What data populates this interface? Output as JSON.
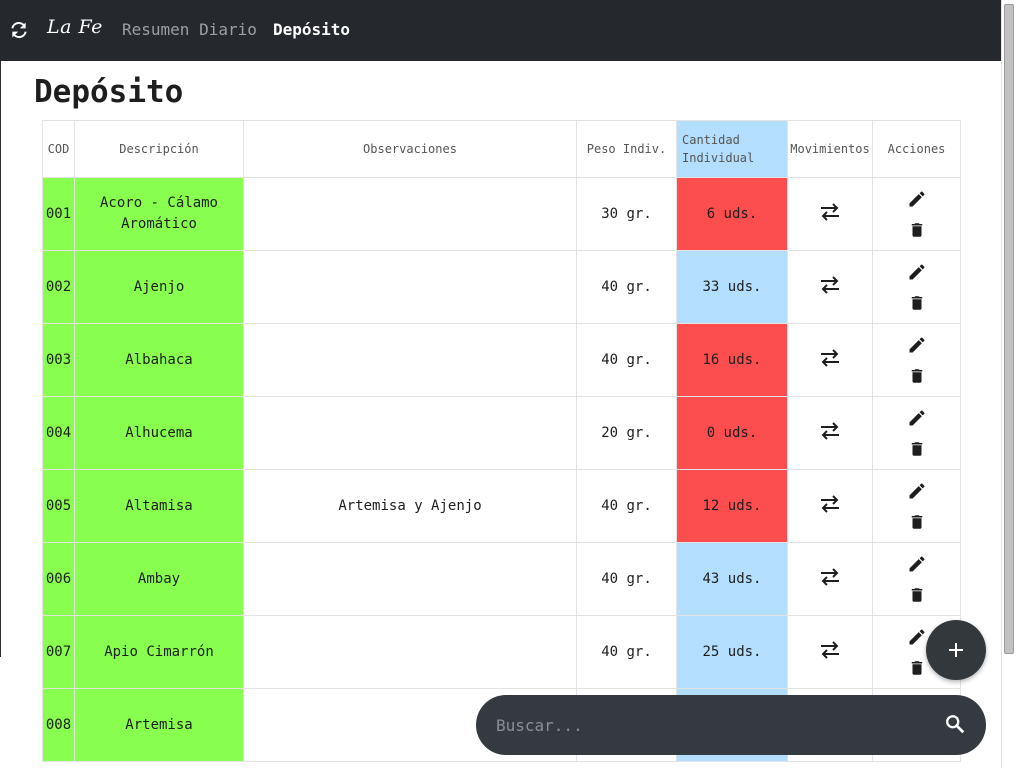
{
  "navbar": {
    "refresh_icon": "refresh-icon",
    "logo": "La Fe",
    "links": [
      "Resumen Diario",
      "Depósito"
    ],
    "active": "Depósito"
  },
  "page": {
    "title": "Depósito"
  },
  "table": {
    "headers": [
      "COD",
      "Descripción",
      "Observaciones",
      "Peso Indiv.",
      "Cantidad Individual",
      "Movimientos",
      "Acciones"
    ],
    "qty_header_line1": "Cantidad",
    "qty_header_line2": "Individual",
    "rows": [
      {
        "cod": "001",
        "desc_l1": "Acoro - Cálamo",
        "desc_l2": "Aromático",
        "obs": "",
        "peso": "30 gr.",
        "cantidad": "6 uds.",
        "status": "low"
      },
      {
        "cod": "002",
        "desc_l1": "Ajenjo",
        "desc_l2": "",
        "obs": "",
        "peso": "40 gr.",
        "cantidad": "33 uds.",
        "status": "ok"
      },
      {
        "cod": "003",
        "desc_l1": "Albahaca",
        "desc_l2": "",
        "obs": "",
        "peso": "40 gr.",
        "cantidad": "16 uds.",
        "status": "low"
      },
      {
        "cod": "004",
        "desc_l1": "Alhucema",
        "desc_l2": "",
        "obs": "",
        "peso": "20 gr.",
        "cantidad": "0 uds.",
        "status": "low"
      },
      {
        "cod": "005",
        "desc_l1": "Altamisa",
        "desc_l2": "",
        "obs": "Artemisa y Ajenjo",
        "peso": "40 gr.",
        "cantidad": "12 uds.",
        "status": "low"
      },
      {
        "cod": "006",
        "desc_l1": "Ambay",
        "desc_l2": "",
        "obs": "",
        "peso": "40 gr.",
        "cantidad": "43 uds.",
        "status": "ok"
      },
      {
        "cod": "007",
        "desc_l1": "Apio Cimarrón",
        "desc_l2": "",
        "obs": "",
        "peso": "40 gr.",
        "cantidad": "25 uds.",
        "status": "ok"
      },
      {
        "cod": "008",
        "desc_l1": "Artemisa",
        "desc_l2": "",
        "obs": "",
        "peso": "",
        "cantidad": "",
        "status": "ok"
      }
    ],
    "movement_icon": "swap-arrows-icon",
    "edit_icon": "pencil-icon",
    "delete_icon": "trash-icon"
  },
  "fab": {
    "icon": "plus-icon"
  },
  "search": {
    "placeholder": "Buscar...",
    "value": "",
    "icon": "search-icon"
  },
  "colors": {
    "navbar": "#25292e",
    "product_green": "#88ff4f",
    "stock_low_red": "#fc4e4f",
    "stock_ok_blue": "#b3defd",
    "fab_bg": "#33383d",
    "search_bg": "#353a40"
  }
}
